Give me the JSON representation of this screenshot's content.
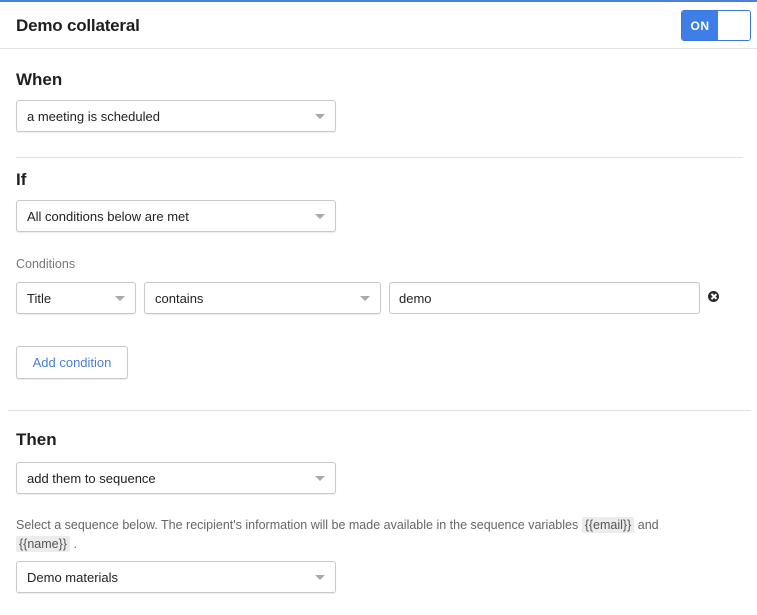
{
  "header": {
    "title": "Demo collateral",
    "toggle": {
      "label": "ON",
      "state": "on",
      "accent": "#3e7ee6"
    }
  },
  "when": {
    "heading": "When",
    "trigger": {
      "value": "a meeting is scheduled",
      "icon": "chevron-down-icon"
    }
  },
  "if": {
    "heading": "If",
    "match": {
      "value": "All conditions below are met",
      "icon": "chevron-down-icon"
    },
    "conditions_label": "Conditions",
    "conditions": [
      {
        "field": "Title",
        "operator": "contains",
        "value": "demo",
        "remove_icon": "close-circle-icon"
      }
    ],
    "add_condition_label": "Add condition"
  },
  "then": {
    "heading": "Then",
    "action": {
      "value": "add them to sequence",
      "icon": "chevron-down-icon"
    },
    "description": {
      "prefix": "Select a sequence below. The recipient's information will be made available in the sequence variables",
      "var_email": "{{email}}",
      "middle": "and",
      "var_name": "{{name}}",
      "suffix": "."
    },
    "sequence": {
      "value": "Demo materials",
      "icon": "chevron-down-icon"
    }
  }
}
